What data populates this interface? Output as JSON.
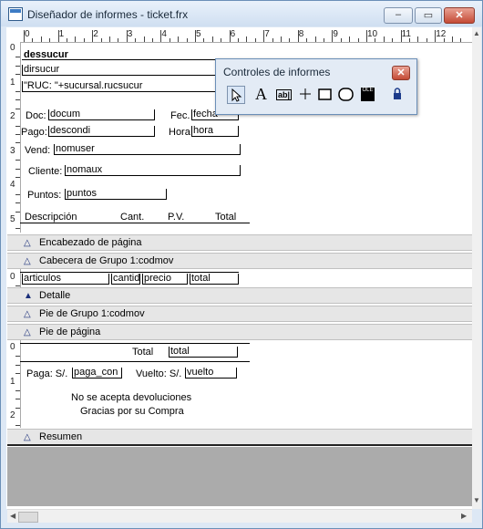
{
  "window": {
    "title": "Diseñador de informes - ticket.frx",
    "minimize_label": "–",
    "maximize_label": "▭",
    "close_label": "✕"
  },
  "ruler": {
    "h_numbers": [
      "0",
      "1",
      "2",
      "3",
      "4",
      "5",
      "6",
      "7",
      "8",
      "9",
      "10",
      "11",
      "12"
    ],
    "v_page_header": [
      "0",
      "1",
      "2",
      "3",
      "4",
      "5"
    ],
    "v_group_header": [
      "0"
    ],
    "v_footer": [
      "0",
      "1",
      "2"
    ]
  },
  "page_header": {
    "dessucur": "dessucur",
    "dirsucur": "dirsucur",
    "ruc": "\"RUC: \"+sucursal.rucsucur",
    "doc_label": "Doc:",
    "doc_field": "docum",
    "fec_label": "Fec.",
    "fec_field": "fecha",
    "pago_label": "Pago:",
    "pago_field": "descondi",
    "hora_label": "Hora",
    "hora_field": "hora",
    "vend_label": "Vend:",
    "vend_field": "nomuser",
    "cliente_label": "Cliente:",
    "cliente_field": "nomaux",
    "puntos_label": "Puntos:",
    "puntos_field": "puntos",
    "col_descripcion": "Descripción",
    "col_cant": "Cant.",
    "col_pv": "P.V.",
    "col_total": "Total"
  },
  "bands": {
    "encabezado": "Encabezado de página",
    "cabecera": "Cabecera de Grupo 1:codmov",
    "detalle": "Detalle",
    "pie_grupo": "Pie de Grupo 1:codmov",
    "pie_pagina": "Pie de página",
    "resumen": "Resumen",
    "triangle_open": "△",
    "triangle_filled": "▲"
  },
  "group_header": {
    "articulos": "articulos",
    "cantidad": "cantid",
    "precio": "precio",
    "total": "total"
  },
  "footer": {
    "total_label": "Total",
    "total_field": "total",
    "paga_label": "Paga: S/.",
    "paga_field": "paga_con",
    "vuelto_label": "Vuelto: S/.",
    "vuelto_field": "vuelto",
    "msg1": "No se acepta devoluciones",
    "msg2": "Gracias por su Compra"
  },
  "palette": {
    "title": "Controles de informes",
    "close_label": "✕",
    "tools": [
      "pointer-tool",
      "label-tool",
      "field-tool",
      "line-tool",
      "rectangle-tool",
      "rounded-rectangle-tool",
      "picture-ole-tool",
      "button-lock-tool"
    ],
    "label_glyph": "A",
    "field_glyph": "ab|",
    "ole_glyph": "OLE"
  },
  "scroll": {
    "up": "▲",
    "down": "▼",
    "left": "◀",
    "right": "▶"
  },
  "colors": {
    "accent": "#1b2f7a",
    "band_bg": "#e6e6e6",
    "gray_area": "#ababab"
  }
}
